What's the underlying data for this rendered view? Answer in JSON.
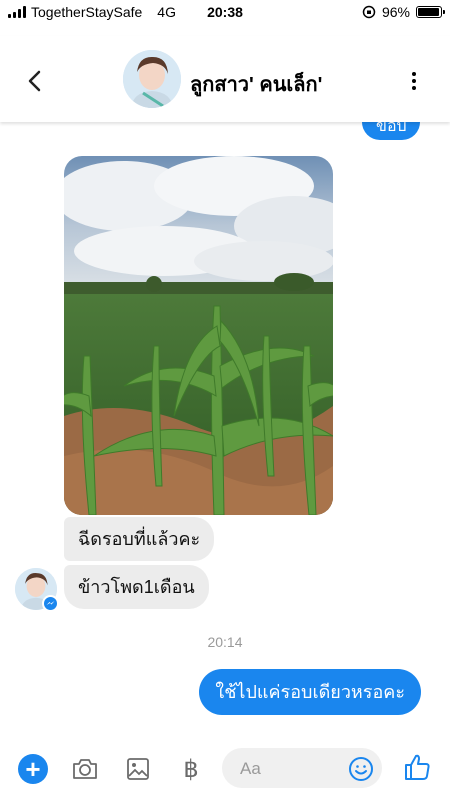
{
  "status_bar": {
    "carrier": "TogetherStaySafe",
    "network": "4G",
    "time": "20:38",
    "battery_percent": "96%",
    "battery_level": 0.96
  },
  "header": {
    "contact_name": "ลูกสาว' คนเล็ก'",
    "back_icon": "chevron-left-icon",
    "more_icon": "more-vertical-icon"
  },
  "messages": {
    "partial_outgoing_text": "ขอบ",
    "incoming_1": "ฉีดรอบที่แล้วคะ",
    "incoming_2": "ข้าวโพด1เดือน",
    "timestamp": "20:14",
    "outgoing_1": "ใช้ไปแค่รอบเดียวหรอคะ"
  },
  "composer": {
    "placeholder": "Aa",
    "baht_symbol": "฿",
    "plus_symbol": "+",
    "icons": [
      "plus-icon",
      "camera-icon",
      "gallery-icon",
      "baht-icon",
      "emoji-icon",
      "thumbs-up-icon"
    ]
  },
  "colors": {
    "accent": "#1a86ee",
    "incoming_bubble": "#ececec",
    "timestamp": "#9a9a9a"
  }
}
